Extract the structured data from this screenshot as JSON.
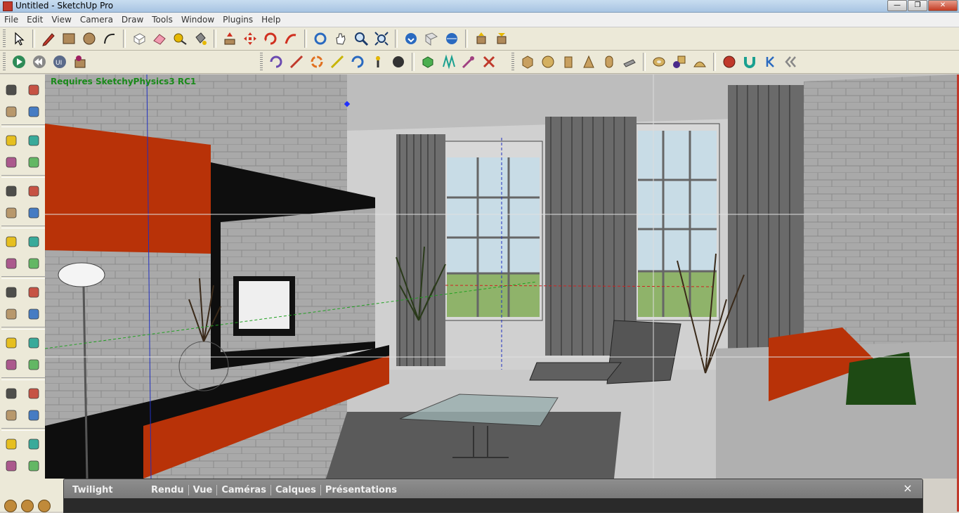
{
  "window": {
    "title": "Untitled - SketchUp Pro",
    "controls": [
      "minimize",
      "maximize",
      "close"
    ]
  },
  "menu": [
    "File",
    "Edit",
    "View",
    "Camera",
    "Draw",
    "Tools",
    "Window",
    "Plugins",
    "Help"
  ],
  "toolbar1": {
    "groups": [
      [
        "select-icon",
        "pencil-icon",
        "rectangle-icon",
        "circle-icon",
        "arc-icon"
      ],
      [
        "make-component-icon",
        "eraser-icon",
        "tape-measure-icon",
        "paint-bucket-icon"
      ],
      [
        "push-pull-icon",
        "move-icon",
        "rotate-icon",
        "follow-me-icon"
      ],
      [
        "orbit-icon",
        "pan-icon",
        "zoom-icon",
        "zoom-extents-icon"
      ],
      [
        "get-models-icon",
        "share-model-icon",
        "google-earth-icon"
      ],
      [
        "get-component-icon",
        "share-component-icon"
      ]
    ]
  },
  "toolbar2": {
    "groups": [
      [
        "play-physics-icon",
        "rewind-icon",
        "physics-ui-icon",
        "joint-connector-icon"
      ],
      [
        "rotate-orange-icon",
        "line-joint-icon",
        "servo-icon",
        "slider-joint-icon",
        "motor-icon",
        "pin-icon",
        "ball-icon"
      ],
      [
        "green-box-icon",
        "spring-icon",
        "piston-icon",
        "cross-icon"
      ],
      [
        "cube-icon",
        "sphere-icon",
        "cylinder-icon",
        "cone-icon",
        "capsule-icon",
        "wedge-icon"
      ],
      [
        "torus-icon",
        "purple-shape-icon",
        "dome-icon"
      ],
      [
        "record-icon",
        "magnet-icon",
        "step-back-icon",
        "double-back-icon"
      ]
    ]
  },
  "left_toolbar": [
    "select-icon",
    "make-component-icon",
    "paint-bucket-icon",
    "eraser-icon",
    "rectangle-icon",
    "pencil-icon",
    "circle-icon",
    "arc-icon",
    "polygon-icon",
    "freehand-icon",
    "move-icon",
    "push-pull-icon",
    "rotate-icon",
    "follow-me-icon",
    "scale-icon",
    "offset-icon",
    "tape-measure-icon",
    "dimension-icon",
    "protractor-icon",
    "text-icon",
    "axes-icon",
    "3d-text-icon",
    "orbit-icon",
    "pan-icon",
    "zoom-icon",
    "zoom-window-icon",
    "previous-view-icon",
    "zoom-extents-icon",
    "position-camera-icon",
    "look-around-icon",
    "walk-icon",
    "section-plane-icon"
  ],
  "viewport": {
    "note": "Requires SketchyPhysics3 RC1"
  },
  "bottom_panel": {
    "title": "Twilight",
    "tabs": [
      "Rendu",
      "Vue",
      "Caméras",
      "Calques",
      "Présentations"
    ],
    "close": "×"
  },
  "colors": {
    "accent_orange": "#b83208",
    "note_green": "#1a8a1a",
    "wall_gray": "#a8a8a8",
    "window_frame": "#d4d0c8"
  }
}
